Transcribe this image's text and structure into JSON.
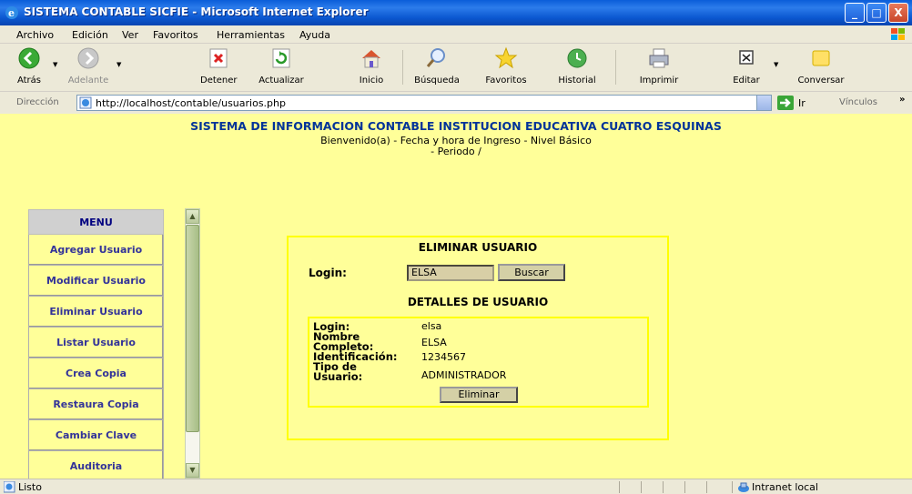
{
  "window": {
    "title": "SISTEMA CONTABLE SICFIE - Microsoft Internet Explorer",
    "minimize": "_",
    "maximize": "□",
    "close": "X"
  },
  "menubar": [
    "Archivo",
    "Edición",
    "Ver",
    "Favoritos",
    "Herramientas",
    "Ayuda"
  ],
  "toolbar": {
    "back": "Atrás",
    "forward": "Adelante",
    "stop": "Detener",
    "refresh": "Actualizar",
    "home": "Inicio",
    "search": "Búsqueda",
    "favorites": "Favoritos",
    "history": "Historial",
    "print": "Imprimir",
    "edit": "Editar",
    "messenger": "Conversar"
  },
  "address": {
    "label": "Dirección",
    "url": "http://localhost/contable/usuarios.php",
    "go": "Ir",
    "links": "Vínculos",
    "links_more": "»"
  },
  "page": {
    "site_title": "SISTEMA DE INFORMACION CONTABLE INSTITUCION EDUCATIVA CUATRO ESQUINAS",
    "welcome_line1": "Bienvenido(a) - Fecha y hora de Ingreso - Nivel Básico",
    "welcome_line2": "- Periodo /",
    "menu": {
      "title": "MENU",
      "items": [
        "Agregar Usuario",
        "Modificar Usuario",
        "Eliminar Usuario",
        "Listar Usuario",
        "Crea Copia",
        "Restaura Copia",
        "Cambiar Clave",
        "Auditoria"
      ]
    },
    "form": {
      "title": "ELIMINAR USUARIO",
      "login_label": "Login:",
      "login_value": "ELSA",
      "search_button": "Buscar",
      "details_title": "DETALLES DE USUARIO",
      "details": {
        "login_label": "Login:",
        "login_value": "elsa",
        "name_label_1": "Nombre",
        "name_label_2": "Completo:",
        "name_value": "ELSA",
        "id_label": "Identificación:",
        "id_value": "1234567",
        "type_label_1": "Tipo de",
        "type_label_2": "Usuario:",
        "type_value": "ADMINISTRADOR"
      },
      "delete_button": "Eliminar"
    }
  },
  "statusbar": {
    "status": "Listo",
    "zone": "Intranet local"
  }
}
